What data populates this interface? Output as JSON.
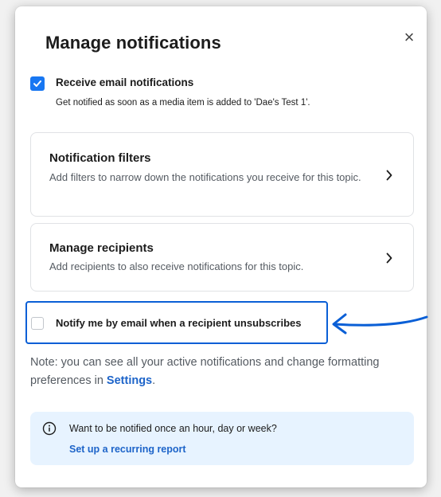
{
  "dialog": {
    "title": "Manage notifications",
    "close_glyph": "×"
  },
  "email_option": {
    "checked": true,
    "label": "Receive email notifications",
    "description": "Get notified as soon as a media item is added to 'Dae's Test 1'."
  },
  "cards": [
    {
      "title": "Notification filters",
      "description": "Add filters to narrow down the notifications you receive for this topic."
    },
    {
      "title": "Manage recipients",
      "description": "Add recipients to also receive notifications for this topic."
    }
  ],
  "unsubscribe_option": {
    "checked": false,
    "label": "Notify me by email when a recipient unsubscribes"
  },
  "note": {
    "prefix": "Note: you can see all your active notifications and change formatting preferences in ",
    "link": "Settings",
    "suffix": "."
  },
  "info_box": {
    "text": "Want to be notified once an hour, day or week?",
    "link": "Set up a recurring report"
  },
  "colors": {
    "accent": "#1877f2",
    "link": "#1d64c9",
    "highlight_annotation": "#0a5fd6",
    "info_background": "#e7f3ff"
  },
  "icons": {
    "close": "close-icon",
    "checkbox": "checkmark-icon",
    "chevron": "chevron-right-icon",
    "info": "info-circle-icon",
    "annotation": "arrow-left-icon"
  }
}
